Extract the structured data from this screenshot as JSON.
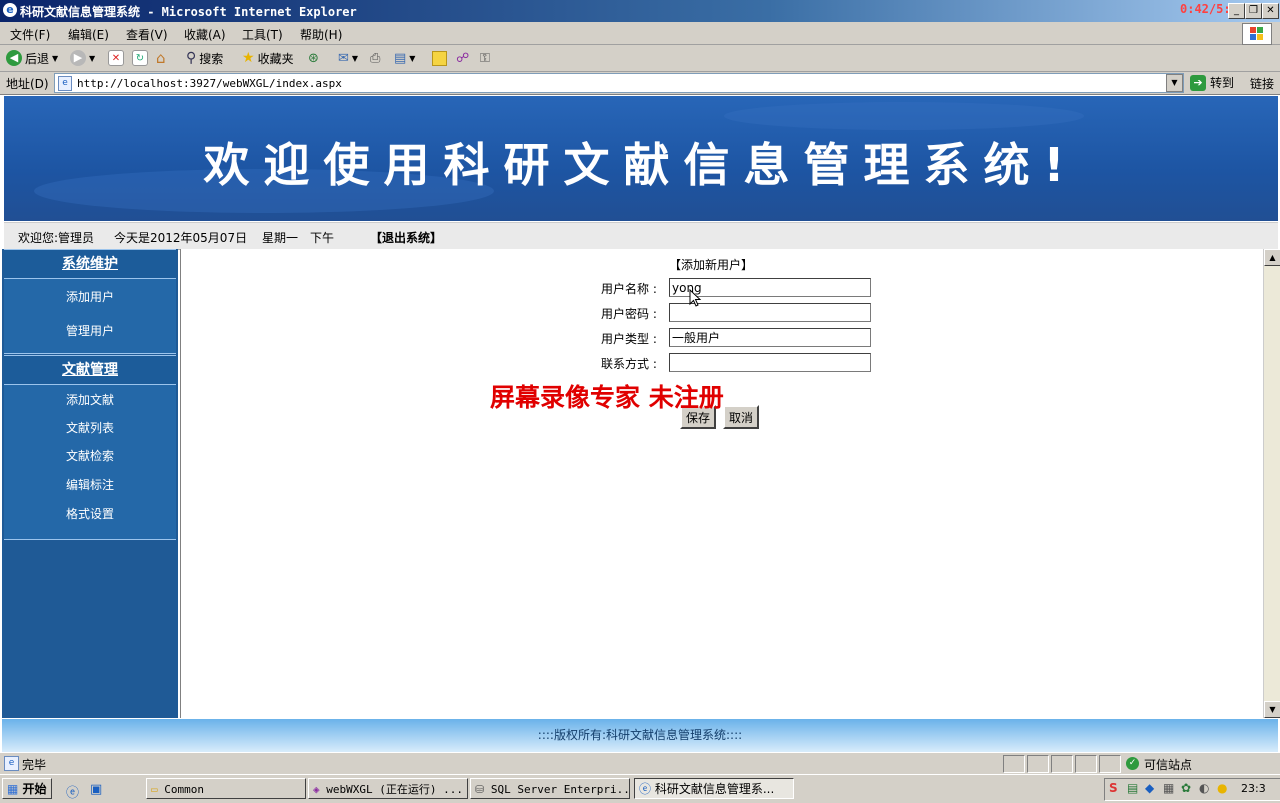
{
  "window": {
    "title": "科研文献信息管理系统 - Microsoft Internet Explorer",
    "timer": "0:42/5:8"
  },
  "menu": [
    "文件(F)",
    "编辑(E)",
    "查看(V)",
    "收藏(A)",
    "工具(T)",
    "帮助(H)"
  ],
  "toolbar": {
    "back": "后退",
    "search": "搜索",
    "favorites": "收藏夹"
  },
  "address": {
    "label": "地址(D)",
    "url": "http://localhost:3927/webWXGL/index.aspx",
    "go": "转到",
    "links": "链接"
  },
  "banner": {
    "title": "欢迎使用科研文献信息管理系统!"
  },
  "infobar": {
    "welcome": "欢迎您:管理员",
    "date": "今天是2012年05月07日",
    "weekday": "星期一",
    "period": "下午",
    "logout": "【退出系统】"
  },
  "sidebar": {
    "sections": [
      {
        "title": "系统维护",
        "items": [
          "添加用户",
          "管理用户"
        ]
      },
      {
        "title": "文献管理",
        "items": [
          "添加文献",
          "文献列表",
          "文献检索",
          "编辑标注",
          "格式设置"
        ]
      }
    ]
  },
  "form": {
    "heading": "【添加新用户】",
    "fields": [
      {
        "label": "用户名称 :",
        "value": "yong"
      },
      {
        "label": "用户密码 :",
        "value": ""
      },
      {
        "label": "用户类型 :",
        "value": "一般用户"
      },
      {
        "label": "联系方式 :",
        "value": ""
      }
    ],
    "save": "保存",
    "cancel": "取消"
  },
  "watermark": "屏幕录像专家  未注册",
  "footer": "::::版权所有:科研文献信息管理系统::::",
  "status": {
    "text": "完毕",
    "zone": "可信站点"
  },
  "taskbar": {
    "start": "开始",
    "tasks": [
      "Common",
      "webWXGL (正在运行) ...",
      "SQL Server Enterpri...",
      "科研文献信息管理系..."
    ],
    "clock": "23:3"
  }
}
